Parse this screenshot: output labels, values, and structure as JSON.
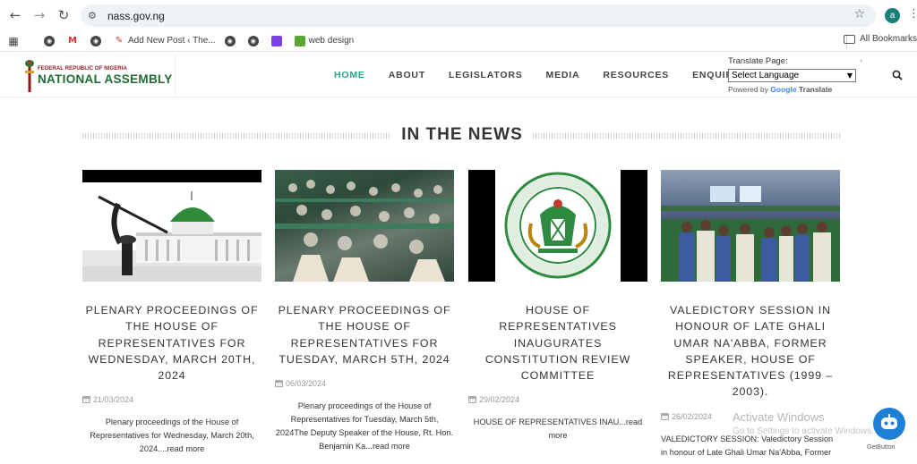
{
  "browser": {
    "url": "nass.gov.ng",
    "profile_initial": "a",
    "bookmarks": [
      {
        "label": "",
        "icon": "globe-icon"
      },
      {
        "label": "",
        "icon": "gmail-icon"
      },
      {
        "label": "",
        "icon": "globe-icon"
      },
      {
        "label": "Add New Post ‹ The...",
        "icon": "wordpress-icon"
      },
      {
        "label": "",
        "icon": "globe-icon"
      },
      {
        "label": "",
        "icon": "globe-icon"
      },
      {
        "label": "",
        "icon": "purple-app-icon"
      },
      {
        "label": "web design",
        "icon": "green-app-icon"
      }
    ],
    "all_bookmarks": "All Bookmarks"
  },
  "site": {
    "logo_top": "FEDERAL REPUBLIC OF NIGERIA",
    "logo_main": "NATIONAL ASSEMBLY",
    "menu": [
      "HOME",
      "ABOUT",
      "LEGISLATORS",
      "MEDIA",
      "RESOURCES",
      "ENQUIRIES"
    ],
    "active_menu": "HOME",
    "translate_label": "Translate Page:",
    "translate_close": "‹",
    "select_language": "Select Language",
    "powered_by": "Powered by",
    "google": "Google",
    "translate_word": "Translate"
  },
  "news": {
    "heading": "IN THE NEWS",
    "cards": [
      {
        "title": "PLENARY PROCEEDINGS OF THE HOUSE OF REPRESENTATIVES FOR WEDNESDAY, MARCH 20TH, 2024",
        "date": "21/03/2024",
        "excerpt": "Plenary proceedings of the House of Representatives for Wednesday, March 20th, 2024....",
        "read_more": "read more"
      },
      {
        "title": "PLENARY PROCEEDINGS OF THE HOUSE OF REPRESENTATIVES FOR TUESDAY, MARCH 5TH, 2024",
        "date": "06/03/2024",
        "excerpt": "Plenary proceedings of the House of Representatives for Tuesday, March 5th, 2024The Deputy Speaker of the House, Rt. Hon. Benjamin Ka...",
        "read_more": "read more"
      },
      {
        "title": "HOUSE OF REPRESENTATIVES INAUGURATES CONSTITUTION REVIEW COMMITTEE",
        "date": "29/02/2024",
        "excerpt": "HOUSE OF REPRESENTATIVES INAU...",
        "read_more": "read more"
      },
      {
        "title": "VALEDICTORY SESSION IN HONOUR OF LATE GHALI UMAR NA'ABBA, FORMER SPEAKER, HOUSE OF REPRESENTATIVES (1999 – 2003).",
        "date": "26/02/2024",
        "excerpt": "VALEDICTORY SESSION:  Valedictory Session in honour of Late Ghali Umar Na'Abba, Former",
        "read_more": ""
      }
    ],
    "seal_text": "HOUSE OF REPRESENTATIVES · FEDERAL REPUBLIC OF NIGERIA"
  },
  "overlay": {
    "activate_title": "Activate Windows",
    "activate_sub": "Go to Settings to activate Windows.",
    "get_button": "GetButton"
  }
}
